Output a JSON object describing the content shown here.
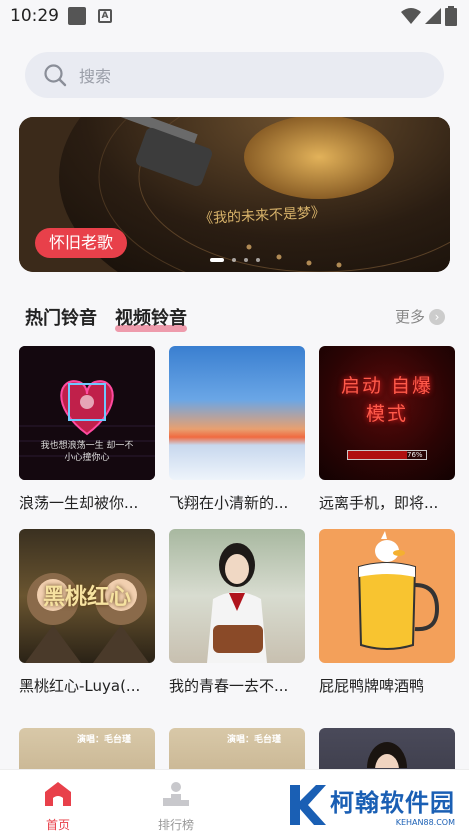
{
  "status": {
    "time": "10:29"
  },
  "search": {
    "placeholder": "搜索"
  },
  "banner": {
    "tag": "怀旧老歌",
    "record_text": "《我的未来不是梦》",
    "slides": 4,
    "active_slide": 0
  },
  "section": {
    "tabs": [
      "热门铃音",
      "视频铃音"
    ],
    "active_tab": 1,
    "more_label": "更多"
  },
  "items": [
    {
      "label": "浪荡一生却被你...",
      "overlay": "我也想浪荡一生 却一不小心撞你心"
    },
    {
      "label": "飞翔在小清新的..."
    },
    {
      "label": "远离手机，即将...",
      "overlay": "启动 自爆模式",
      "progress_text": "76%",
      "progress": 0.76
    },
    {
      "label": "黑桃红心-Luya(...",
      "overlay": "黑桃红心"
    },
    {
      "label": "我的青春一去不..."
    },
    {
      "label": "屁屁鸭牌啤酒鸭"
    },
    {
      "overlay": "演唱：毛台瑾"
    },
    {
      "overlay": "演唱：毛台瑾"
    },
    {}
  ],
  "tabbar": {
    "items": [
      {
        "label": "首页",
        "icon": "home-icon"
      },
      {
        "label": "排行榜",
        "icon": "ranking-icon"
      }
    ],
    "active": 0
  },
  "watermark": {
    "text": "柯翰软件园",
    "sub": "KEHAN88.COM"
  },
  "colors": {
    "accent": "#e8404a",
    "tab_underline": "#e8506e",
    "active_tab": "#e8404a"
  }
}
